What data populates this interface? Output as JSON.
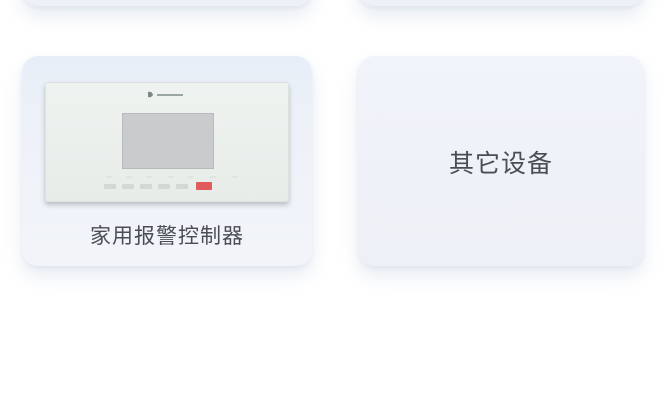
{
  "devices": [
    {
      "label": "家用报警控制器",
      "icon": "alarm-controller-device"
    },
    {
      "label": "其它设备",
      "icon": ""
    }
  ],
  "colors": {
    "card_bg": "#eef1f7",
    "label_text": "#4a4d55",
    "device_screen": "#c9cbcd",
    "alarm_key": "#e25b5b"
  }
}
